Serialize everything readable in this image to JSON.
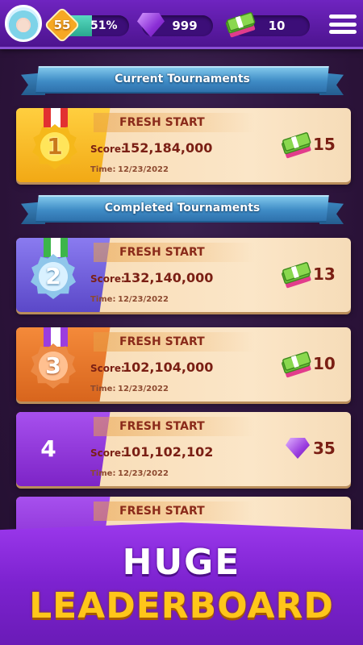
{
  "header": {
    "level": "55",
    "level_percent": "51%",
    "level_progress": 0.51,
    "gems": "999",
    "cash": "10",
    "icons": [
      "avatar",
      "level-badge-icon",
      "gem-icon",
      "cash-icon",
      "menu-icon"
    ]
  },
  "sections": {
    "current": "Current Tournaments",
    "completed": "Completed Tournaments"
  },
  "labels": {
    "score": "Score:",
    "time": "Time:"
  },
  "cards": [
    {
      "rank": "1",
      "title": "FRESH START",
      "score": "152,184,000",
      "time": "12/23/2022",
      "reward": "15",
      "reward_type": "cash"
    },
    {
      "rank": "2",
      "title": "FRESH START",
      "score": "132,140,000",
      "time": "12/23/2022",
      "reward": "13",
      "reward_type": "cash"
    },
    {
      "rank": "3",
      "title": "FRESH START",
      "score": "102,104,000",
      "time": "12/23/2022",
      "reward": "10",
      "reward_type": "cash"
    },
    {
      "rank": "4",
      "title": "FRESH START",
      "score": "101,102,102",
      "time": "12/23/2022",
      "reward": "35",
      "reward_type": "gem"
    },
    {
      "title": "FRESH START"
    }
  ],
  "promo": {
    "line1": "HUGE",
    "line2": "LEADERBOARD"
  },
  "colors": {
    "topbar": "#6f24c0",
    "banner": "#3f8cc6",
    "card": "#fbe6c8",
    "gold": "#f2a915",
    "silver": "#5b48c8",
    "bronze": "#d8651d",
    "purple": "#7d24c7",
    "promo_text": "#ffc61a"
  }
}
